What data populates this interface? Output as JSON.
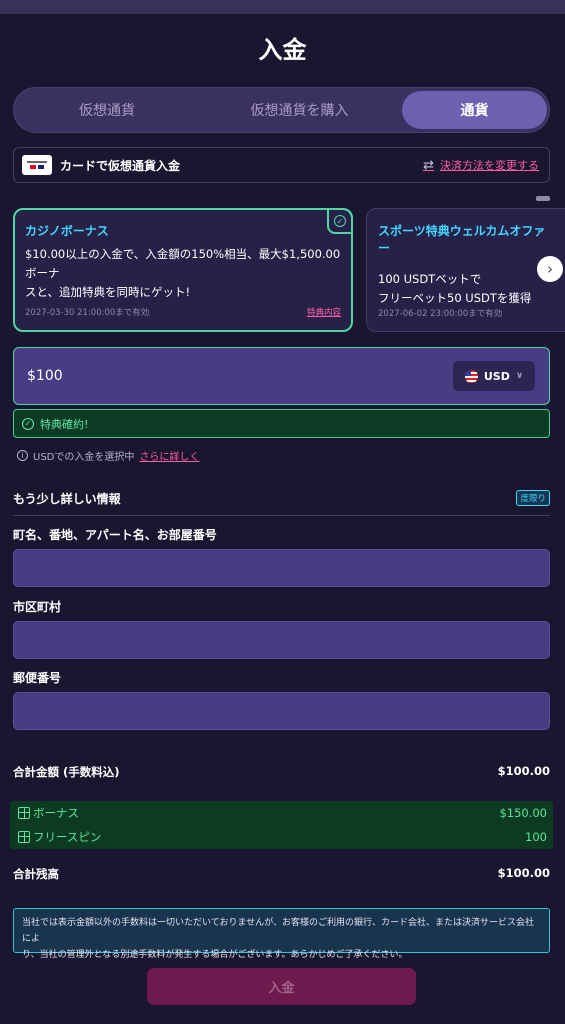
{
  "page": {
    "title": "入金"
  },
  "tabs": [
    {
      "label": "仮想通貨",
      "active": false
    },
    {
      "label": "仮想通貨を購入",
      "active": false
    },
    {
      "label": "通貨",
      "active": true
    }
  ],
  "payment": {
    "label": "カードで仮想通貨入金",
    "change_label": "決済方法を変更する"
  },
  "bonuses": [
    {
      "title": "カジノボーナス",
      "desc1": "$10.00以上の入金で、入金額の150%相当、最大$1,500.00ボーナ",
      "desc2": "スと、追加特典を同時にゲット!",
      "valid": "2027-03-30 21:00:00まで有効",
      "link": "特典内容",
      "selected": true
    },
    {
      "title": "スポーツ特典ウェルカムオファー",
      "desc1": "100 USDTベットで",
      "desc2": "フリーベット50 USDTを獲得",
      "valid": "2027-06-02 23:00:00まで有効",
      "selected": false
    }
  ],
  "amount": {
    "value": "$100",
    "currency": "USD"
  },
  "confirmed_text": "特典確約!",
  "info": {
    "text": "USDでの入金を選択中",
    "more": "さらに詳しく"
  },
  "details": {
    "heading": "もう少し詳しい情報",
    "badge": "度限り",
    "fields": [
      {
        "label": "町名、番地、アパート名、お部屋番号",
        "value": ""
      },
      {
        "label": "市区町村",
        "value": ""
      },
      {
        "label": "郵便番号",
        "value": ""
      }
    ]
  },
  "summary": {
    "total_label": "合計金額 (手数料込)",
    "total_value": "$100.00",
    "bonus_label": "ボーナス",
    "bonus_value": "$150.00",
    "freespin_label": "フリースピン",
    "freespin_value": "100",
    "balance_label": "合計残高",
    "balance_value": "$100.00"
  },
  "notice": {
    "line1": "当社では表示金額以外の手数料は一切いただいておりませんが、お客様のご利用の銀行、カード会社、または決済サービス会社によ",
    "line2": "り、当社の管理外となる別途手数料が発生する場合がございます。あらかじめご了承ください。"
  },
  "deposit_button": "入金",
  "colors": {
    "accent_green": "#4ed6a4",
    "accent_pink": "#ff5fa3",
    "accent_cyan": "#42d7ff",
    "background": "#1a1630"
  },
  "icons": [
    "check-icon",
    "swap-icon",
    "chevron-right-icon",
    "chevron-down-icon",
    "us-flag-icon",
    "info-icon",
    "gift-icon"
  ]
}
